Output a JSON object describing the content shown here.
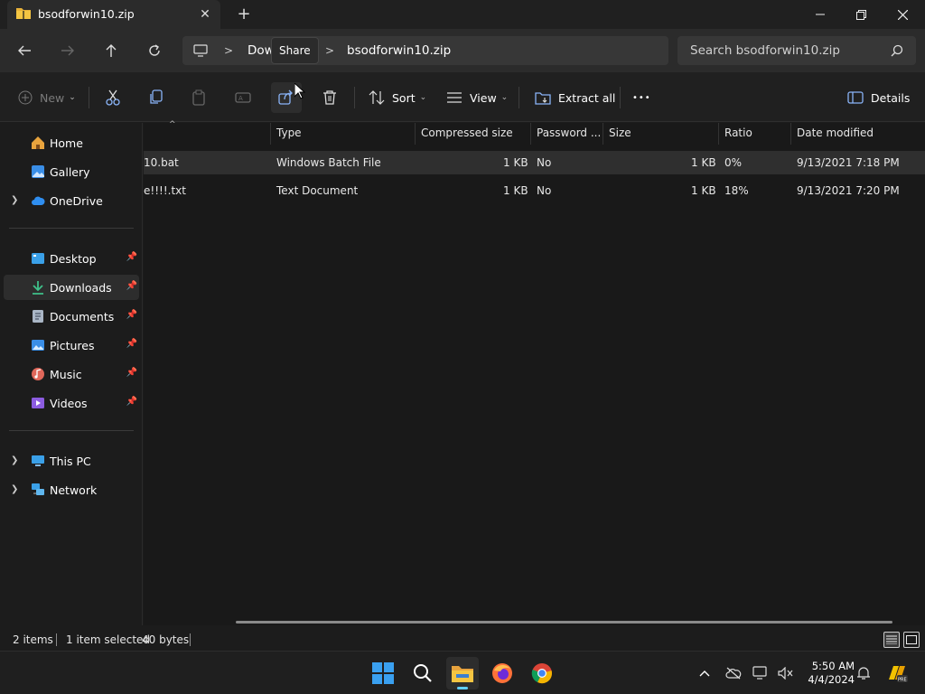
{
  "window": {
    "tab_title": "bsodforwin10.zip",
    "new_tab_glyph": "+",
    "controls": {
      "minimize_icon": "minimize-icon",
      "maximize_icon": "restore-icon",
      "close_icon": "close-icon"
    }
  },
  "address": {
    "crumbs": [
      "Dow",
      "bsodforwin10.zip"
    ],
    "tooltip": "Share",
    "search_placeholder": "Search bsodforwin10.zip"
  },
  "commandbar": {
    "new_label": "New",
    "sort_label": "Sort",
    "view_label": "View",
    "extract_label": "Extract all",
    "details_label": "Details",
    "more_glyph": "•••"
  },
  "sidebar": {
    "items": [
      {
        "label": "Home",
        "icon": "home-icon"
      },
      {
        "label": "Gallery",
        "icon": "gallery-icon"
      },
      {
        "label": "OneDrive",
        "icon": "cloud-icon"
      },
      {
        "label": "Desktop",
        "icon": "desktop-icon"
      },
      {
        "label": "Downloads",
        "icon": "download-icon"
      },
      {
        "label": "Documents",
        "icon": "document-icon"
      },
      {
        "label": "Pictures",
        "icon": "pictures-icon"
      },
      {
        "label": "Music",
        "icon": "music-icon"
      },
      {
        "label": "Videos",
        "icon": "video-icon"
      },
      {
        "label": "This PC",
        "icon": "pc-icon"
      },
      {
        "label": "Network",
        "icon": "network-icon"
      }
    ]
  },
  "filelist": {
    "columns": [
      "Type",
      "Compressed size",
      "Password ...",
      "Size",
      "Ratio",
      "Date modified"
    ],
    "rows": [
      {
        "name": "10.bat",
        "type": "Windows Batch File",
        "compressed": "1 KB",
        "password": "No",
        "size": "1 KB",
        "ratio": "0%",
        "date": "9/13/2021 7:18 PM"
      },
      {
        "name": "e!!!!.txt",
        "type": "Text Document",
        "compressed": "1 KB",
        "password": "No",
        "size": "1 KB",
        "ratio": "18%",
        "date": "9/13/2021 7:20 PM"
      }
    ]
  },
  "status": {
    "items": "2 items",
    "selected": "1 item selected",
    "size": "40 bytes"
  },
  "taskbar": {
    "time": "5:50 AM",
    "date": "4/4/2024",
    "apps": [
      "start-icon",
      "search-icon",
      "file-explorer-icon",
      "firefox-icon",
      "chrome-icon"
    ]
  },
  "colors": {
    "accent": "#60cdff",
    "folder": "#f4c542"
  }
}
